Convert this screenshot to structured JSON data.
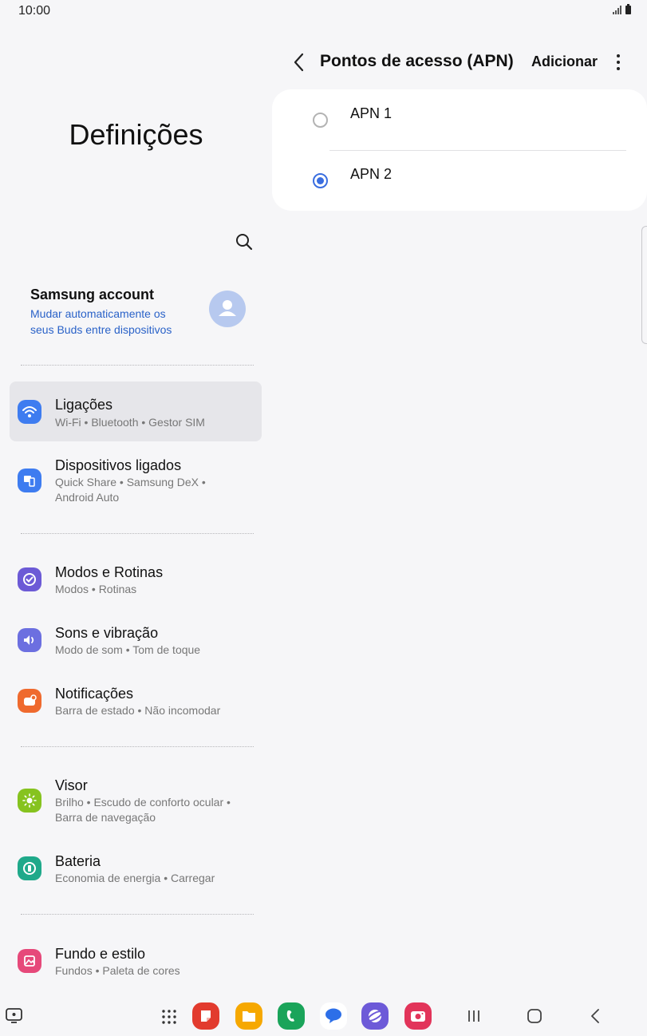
{
  "status_bar": {
    "time": "10:00"
  },
  "left_pane": {
    "title": "Definições",
    "account": {
      "name": "Samsung account",
      "subtitle": "Mudar automaticamente os seus Buds entre dispositivos"
    },
    "menu": [
      {
        "title": "Ligações",
        "subtitle": "Wi-Fi • Bluetooth • Gestor SIM",
        "icon": "wifi-icon",
        "color": "#3e7cf0",
        "selected": true
      },
      {
        "title": "Dispositivos ligados",
        "subtitle": "Quick Share • Samsung DeX • Android Auto",
        "icon": "connected-devices-icon",
        "color": "#3e7cf0"
      },
      {
        "title": "Modos e Rotinas",
        "subtitle": "Modos • Rotinas",
        "icon": "modes-routines-icon",
        "color": "#6c5ad6"
      },
      {
        "title": "Sons e vibração",
        "subtitle": "Modo de som • Tom de toque",
        "icon": "speaker-icon",
        "color": "#6c6fe0"
      },
      {
        "title": "Notificações",
        "subtitle": "Barra de estado • Não incomodar",
        "icon": "notification-icon",
        "color": "#ef6a2e"
      },
      {
        "title": "Visor",
        "subtitle": "Brilho • Escudo de conforto ocular • Barra de navegação",
        "icon": "sun-icon",
        "color": "#86c31f"
      },
      {
        "title": "Bateria",
        "subtitle": "Economia de energia • Carregar",
        "icon": "battery-icon",
        "color": "#1fa98a"
      },
      {
        "title": "Fundo e estilo",
        "subtitle": "Fundos • Paleta de cores",
        "icon": "wallpaper-icon",
        "color": "#e6497a"
      }
    ]
  },
  "right_pane": {
    "title": "Pontos de acesso (APN)",
    "add_label": "Adicionar",
    "apns": [
      {
        "label": "APN 1",
        "selected": false
      },
      {
        "label": "APN 2",
        "selected": true
      }
    ]
  },
  "accent_color": "#3a6ee0",
  "navbar": {
    "apps": [
      "app-drawer-icon",
      "notes-app-icon",
      "files-app-icon",
      "phone-app-icon",
      "messages-app-icon",
      "internet-app-icon",
      "camera-app-icon"
    ]
  }
}
